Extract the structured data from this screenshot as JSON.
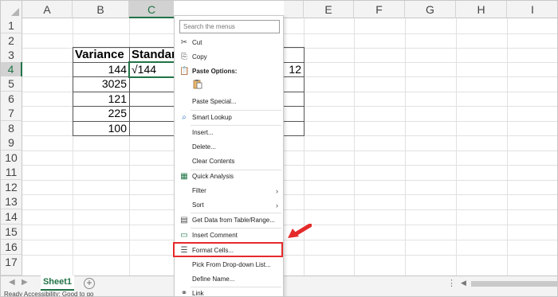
{
  "columns": [
    "A",
    "B",
    "C",
    "D",
    "E",
    "F",
    "G",
    "H",
    "I"
  ],
  "rows": [
    "1",
    "2",
    "3",
    "4",
    "5",
    "6",
    "7",
    "8",
    "9",
    "10",
    "11",
    "12",
    "13",
    "14",
    "15",
    "16",
    "17"
  ],
  "selected_column": "C",
  "selected_row": "4",
  "cells": {
    "b3": "Variance",
    "c3": "Standard",
    "b4": "144",
    "c4": "√144",
    "d4": "12",
    "b5": "3025",
    "b6": "121",
    "b7": "225",
    "b8": "100"
  },
  "context_menu": {
    "search_placeholder": "Search the menus",
    "cut": "Cut",
    "copy": "Copy",
    "paste_options": "Paste Options:",
    "paste_special": "Paste Special...",
    "smart_lookup": "Smart Lookup",
    "insert": "Insert...",
    "delete": "Delete...",
    "clear_contents": "Clear Contents",
    "quick_analysis": "Quick Analysis",
    "filter": "Filter",
    "sort": "Sort",
    "get_data": "Get Data from Table/Range...",
    "insert_comment": "Insert Comment",
    "format_cells": "Format Cells...",
    "pick_from_list": "Pick From Drop-down List...",
    "define_name": "Define Name...",
    "link": "Link"
  },
  "sheet_tabs": [
    "Sheet1"
  ],
  "status": "Ready    Accessibility: Good to go",
  "colors": {
    "accent": "#217346",
    "highlight": "#e52a2a"
  }
}
